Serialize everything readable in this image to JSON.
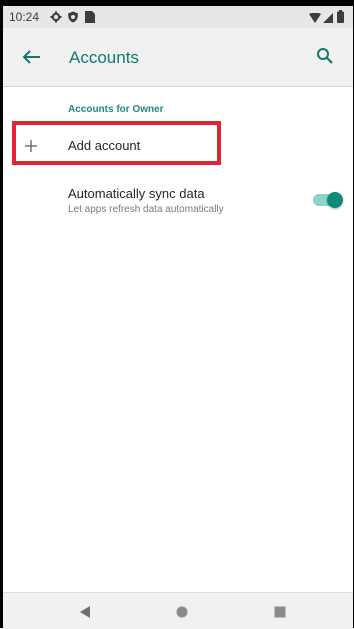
{
  "status_bar": {
    "time": "10:24",
    "icons": [
      "settings-icon",
      "shield-icon",
      "sim-card-icon",
      "wifi-icon",
      "signal-icon",
      "battery-icon"
    ]
  },
  "app_bar": {
    "title": "Accounts",
    "back_icon": "back-arrow-icon",
    "search_icon": "search-icon",
    "accent_color": "#0f7a6e"
  },
  "section": {
    "header": "Accounts for Owner"
  },
  "add_account": {
    "label": "Add account",
    "icon": "plus-icon",
    "highlight_color": "#e32336"
  },
  "sync": {
    "title": "Automatically sync data",
    "subtitle": "Let apps refresh data automatically",
    "enabled": true,
    "toggle_color": "#0f8a77"
  },
  "nav_bar": {
    "buttons": [
      "back-nav-icon",
      "home-nav-icon",
      "recents-nav-icon"
    ]
  }
}
